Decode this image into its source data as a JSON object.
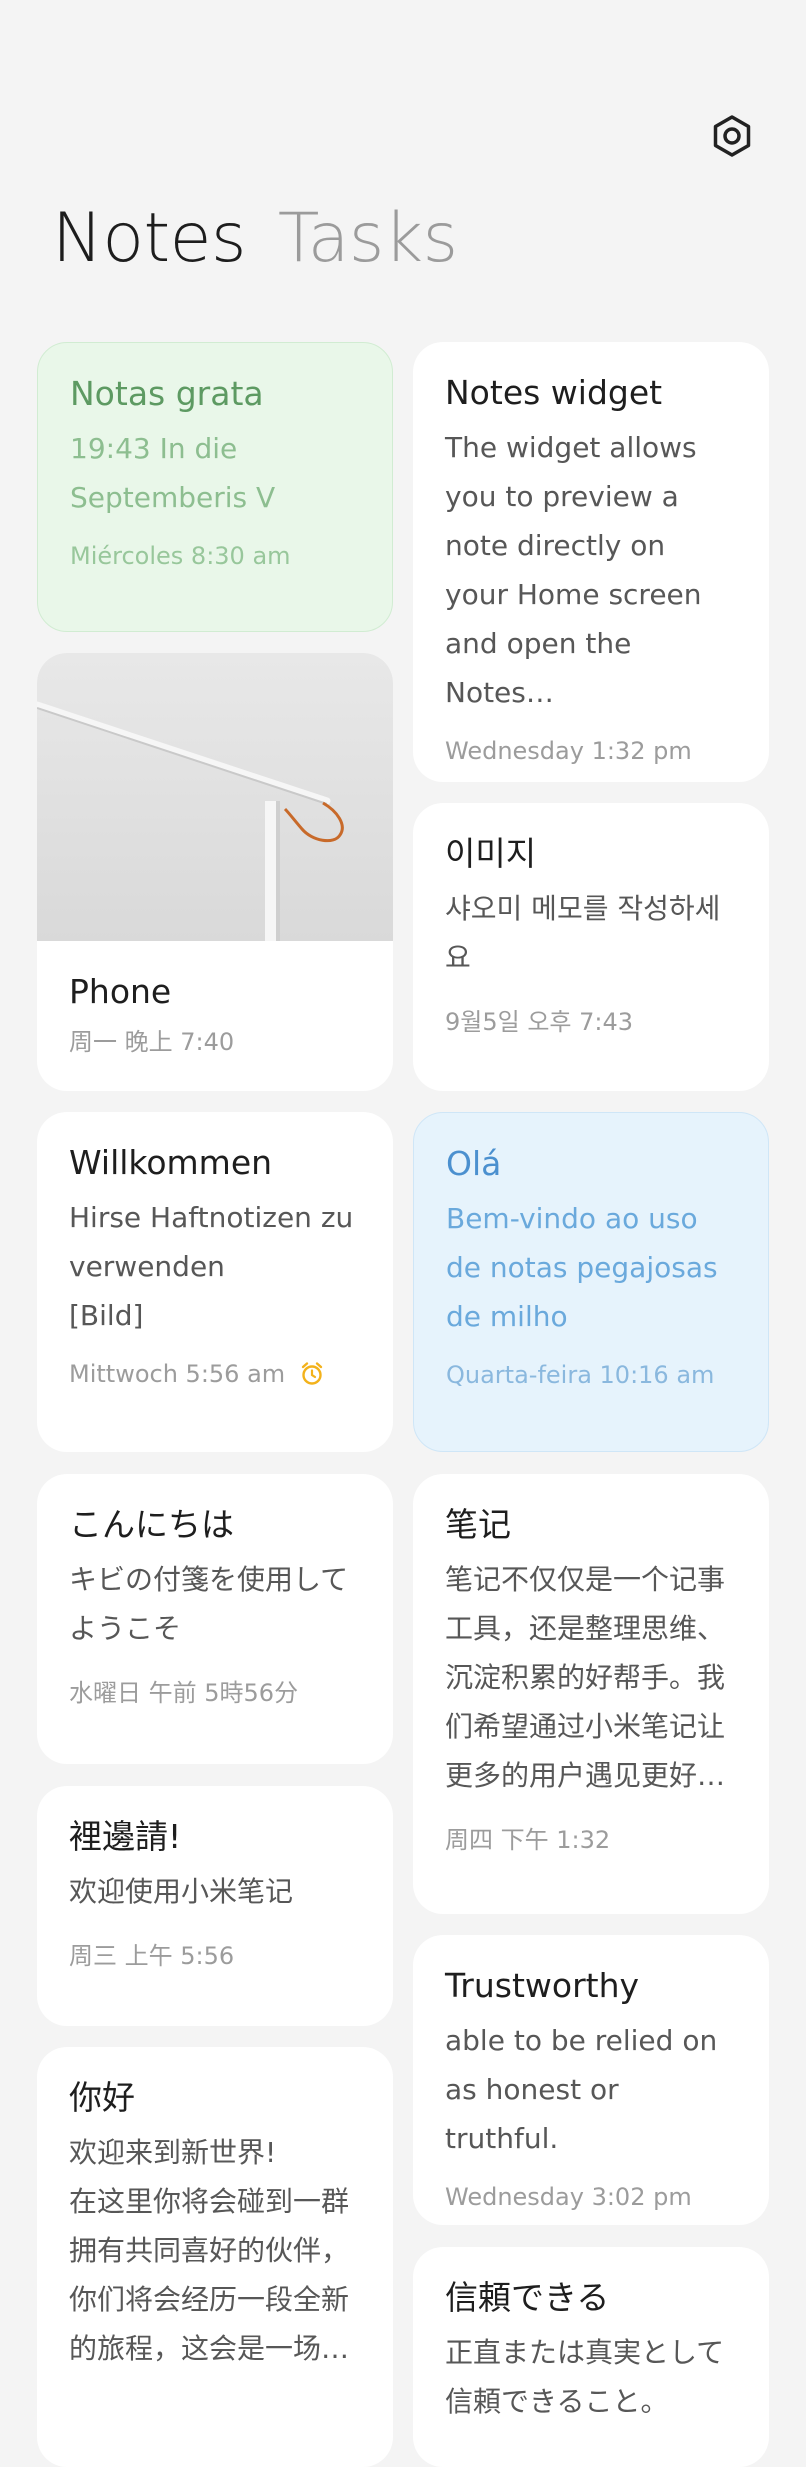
{
  "header": {
    "tabs": [
      {
        "label": "Notes",
        "active": true
      },
      {
        "label": "Tasks",
        "active": false
      }
    ],
    "settings_icon": "gear-icon"
  },
  "notes_left": [
    {
      "title": "Notas grata",
      "body": "19:43 In die Septemberis V",
      "date": "Miércoles 8:30 am",
      "color": "#e9f7e9"
    },
    {
      "title": "Phone",
      "body": "",
      "date": "周一 晚上 7:40",
      "has_image": true
    },
    {
      "title": "Willkommen",
      "body": "Hirse Haftnotizen zu verwenden\n[Bild]",
      "date": "Mittwoch 5:56 am",
      "alarm_icon": "alarm-clock-icon"
    },
    {
      "title": "こんにちは",
      "body": "キビの付箋を使用してようこそ",
      "date": "水曜日 午前 5時56分"
    },
    {
      "title": "裡邊請!",
      "body": "欢迎使用小米笔记",
      "date": "周三 上午 5:56"
    },
    {
      "title": "你好",
      "body": "欢迎来到新世界!\n在这里你将会碰到一群拥有共同喜好的伙伴，你们将会经历一段全新的旅程，这会是一场…",
      "date": ""
    }
  ],
  "notes_right": [
    {
      "title": "Notes widget",
      "body": "The widget allows you to preview a note directly on your Home screen and open the Notes…",
      "date": "Wednesday 1:32 pm"
    },
    {
      "title": "이미지",
      "body": "샤오미 메모를 작성하세요",
      "date": "9월5일 오후 7:43"
    },
    {
      "title": "Olá",
      "body": "Bem-vindo ao uso de notas pegajosas de milho",
      "date": "Quarta-feira 10:16 am",
      "color": "#e6f3fc"
    },
    {
      "title": "笔记",
      "body": "笔记不仅仅是一个记事工具，还是整理思维、沉淀积累的好帮手。我们希望通过小米笔记让更多的用户遇见更好…",
      "date": "周四 下午 1:32"
    },
    {
      "title": "Trustworthy",
      "body": "able to be relied on as honest or truthful.",
      "date": "Wednesday 3:02 pm"
    },
    {
      "title": "信頼できる",
      "body": "正直または真実として信頼できること。",
      "date": ""
    }
  ],
  "colors": {
    "background": "#f4f4f4",
    "card": "#ffffff",
    "green_title": "#5d9a62",
    "blue_title": "#4b90cf",
    "alarm": "#f3b21b"
  }
}
